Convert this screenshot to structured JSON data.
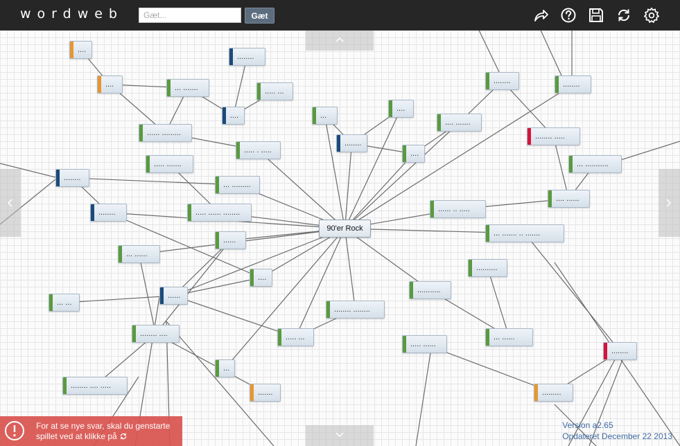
{
  "app": {
    "logo": "wordweb"
  },
  "search": {
    "placeholder": "Gæt...",
    "value": "",
    "button_label": "Gæt"
  },
  "toolbar": {
    "icons": [
      "share-icon",
      "help-icon",
      "save-icon",
      "refresh-icon",
      "settings-icon"
    ]
  },
  "colors": {
    "topbar": "#262626",
    "orange": "#e8962e",
    "blue": "#1b4a7a",
    "green": "#5a9a3e",
    "red": "#d4143c",
    "notice": "#d9534f",
    "version_text": "#3f6aa3"
  },
  "center_node": {
    "id": "center",
    "label": "90'er Rock"
  },
  "nodes": [
    {
      "id": "n1",
      "label": "....",
      "color": "orange"
    },
    {
      "id": "n2",
      "label": "........",
      "color": "blue"
    },
    {
      "id": "n3",
      "label": "....",
      "color": "orange"
    },
    {
      "id": "n4",
      "label": "... .......",
      "color": "green"
    },
    {
      "id": "n5",
      "label": "..... ...",
      "color": "green"
    },
    {
      "id": "n6",
      "label": "....",
      "color": "blue"
    },
    {
      "id": "n7",
      "label": "...",
      "color": "green"
    },
    {
      "id": "n8",
      "label": "....",
      "color": "green"
    },
    {
      "id": "n9",
      "label": "........",
      "color": "green"
    },
    {
      "id": "n10",
      "label": "........",
      "color": "green"
    },
    {
      "id": "n11",
      "label": "...... .........",
      "color": "green"
    },
    {
      "id": "n12",
      "label": "..... . .....",
      "color": "green"
    },
    {
      "id": "n13",
      "label": "........",
      "color": "blue"
    },
    {
      "id": "n14",
      "label": ".... .......",
      "color": "green"
    },
    {
      "id": "n15",
      "label": "........ .....",
      "color": "red"
    },
    {
      "id": "n16",
      "label": "....",
      "color": "green"
    },
    {
      "id": "n17",
      "label": "..... .......",
      "color": "green"
    },
    {
      "id": "n18",
      "label": "........",
      "color": "blue"
    },
    {
      "id": "n19",
      "label": "... .........",
      "color": "green"
    },
    {
      "id": "n20",
      "label": "... ...........",
      "color": "green"
    },
    {
      "id": "n21",
      "label": "........",
      "color": "blue"
    },
    {
      "id": "n22",
      "label": "..... ...... ........",
      "color": "green"
    },
    {
      "id": "n23",
      "label": "...... .. .....",
      "color": "green"
    },
    {
      "id": "n24",
      "label": ".... ......",
      "color": "green"
    },
    {
      "id": "n25",
      "label": "... ....... .. .......",
      "color": "green"
    },
    {
      "id": "n26",
      "label": "......",
      "color": "green"
    },
    {
      "id": "n27",
      "label": "... ......",
      "color": "green"
    },
    {
      "id": "n28",
      "label": "..........",
      "color": "green"
    },
    {
      "id": "n29",
      "label": "....",
      "color": "green"
    },
    {
      "id": "n30",
      "label": "......",
      "color": "blue"
    },
    {
      "id": "n31",
      "label": "... ...",
      "color": "green"
    },
    {
      "id": "n32",
      "label": "...........",
      "color": "green"
    },
    {
      "id": "n33",
      "label": "........ ........",
      "color": "green"
    },
    {
      "id": "n34",
      "label": "........ ....",
      "color": "green"
    },
    {
      "id": "n35",
      "label": "..... ...",
      "color": "green"
    },
    {
      "id": "n36",
      "label": "..... ......",
      "color": "green"
    },
    {
      "id": "n37",
      "label": "... ......",
      "color": "green"
    },
    {
      "id": "n38",
      "label": "........",
      "color": "red"
    },
    {
      "id": "n39",
      "label": "...",
      "color": "green"
    },
    {
      "id": "n40",
      "label": "........ .... .....",
      "color": "green"
    },
    {
      "id": "n41",
      "label": ".......",
      "color": "orange"
    },
    {
      "id": "n42",
      "label": ".........",
      "color": "orange"
    }
  ],
  "notice": {
    "text": "For at se nye svar, skal du genstarte spillet ved at klikke på"
  },
  "version": {
    "line1": "Version a2.65",
    "line2": "Opdateret December 22 2013"
  }
}
